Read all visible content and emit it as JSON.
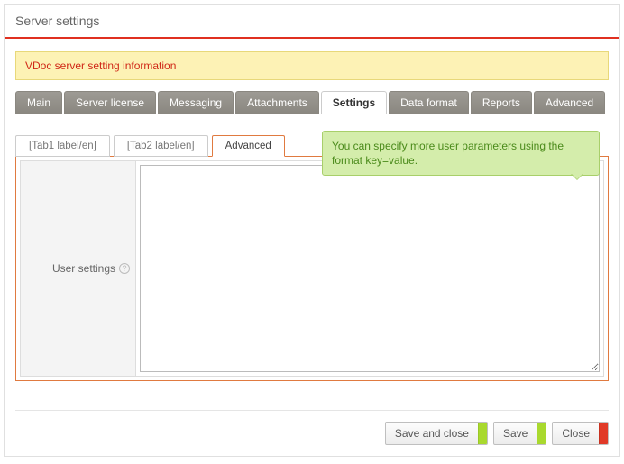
{
  "header": {
    "title": "Server settings"
  },
  "info": {
    "message": "VDoc server setting information"
  },
  "primaryTabs": {
    "items": [
      {
        "label": "Main"
      },
      {
        "label": "Server license"
      },
      {
        "label": "Messaging"
      },
      {
        "label": "Attachments"
      },
      {
        "label": "Settings"
      },
      {
        "label": "Data format"
      },
      {
        "label": "Reports"
      },
      {
        "label": "Advanced"
      }
    ],
    "activeIndex": 4
  },
  "secondaryTabs": {
    "items": [
      {
        "label": "[Tab1 label/en]"
      },
      {
        "label": "[Tab2 label/en]"
      },
      {
        "label": "Advanced"
      }
    ],
    "activeIndex": 2
  },
  "tooltip": {
    "text": "You can specify more user parameters using the format key=value."
  },
  "form": {
    "userSettings": {
      "label": "User settings",
      "value": ""
    }
  },
  "footer": {
    "saveAndClose": "Save and close",
    "save": "Save",
    "close": "Close"
  }
}
